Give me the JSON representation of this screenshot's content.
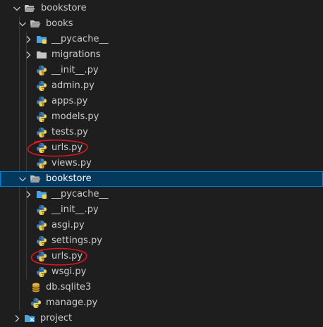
{
  "explorer": {
    "root": {
      "label": "bookstore",
      "expanded": true,
      "icon": "folder-open-icon"
    },
    "books": {
      "label": "books",
      "expanded": true,
      "children": [
        {
          "label": "__pycache__",
          "type": "folder",
          "icon": "pycache-folder-icon"
        },
        {
          "label": "migrations",
          "type": "folder",
          "icon": "folder-icon"
        },
        {
          "label": "__init__.py",
          "type": "file",
          "icon": "python-file-icon"
        },
        {
          "label": "admin.py",
          "type": "file",
          "icon": "python-file-icon"
        },
        {
          "label": "apps.py",
          "type": "file",
          "icon": "python-file-icon"
        },
        {
          "label": "models.py",
          "type": "file",
          "icon": "python-file-icon"
        },
        {
          "label": "tests.py",
          "type": "file",
          "icon": "python-file-icon"
        },
        {
          "label": "urls.py",
          "type": "file",
          "icon": "python-file-icon",
          "circled": true
        },
        {
          "label": "views.py",
          "type": "file",
          "icon": "python-file-icon"
        }
      ]
    },
    "bookstore_pkg": {
      "label": "bookstore",
      "expanded": true,
      "selected": true,
      "children": [
        {
          "label": "__pycache__",
          "type": "folder",
          "icon": "pycache-folder-icon"
        },
        {
          "label": "__init__.py",
          "type": "file",
          "icon": "python-file-icon"
        },
        {
          "label": "asgi.py",
          "type": "file",
          "icon": "python-file-icon"
        },
        {
          "label": "settings.py",
          "type": "file",
          "icon": "python-file-icon"
        },
        {
          "label": "urls.py",
          "type": "file",
          "icon": "python-file-icon",
          "circled": true
        },
        {
          "label": "wsgi.py",
          "type": "file",
          "icon": "python-file-icon"
        }
      ]
    },
    "root_files": [
      {
        "label": "db.sqlite3",
        "type": "file",
        "icon": "database-icon"
      },
      {
        "label": "manage.py",
        "type": "file",
        "icon": "python-file-icon"
      }
    ],
    "project": {
      "label": "project",
      "expanded": false,
      "icon": "project-folder-icon"
    }
  },
  "colors": {
    "background": "#1e1e1e",
    "text": "#cccccc",
    "selection": "#04395e",
    "selection_border": "#007fd4",
    "annotation": "#e0141e",
    "python_blue": "#3c7ab8",
    "python_yellow": "#f7d34a",
    "folder": "#c5c5c5",
    "folder_blue": "#4aa3df"
  }
}
